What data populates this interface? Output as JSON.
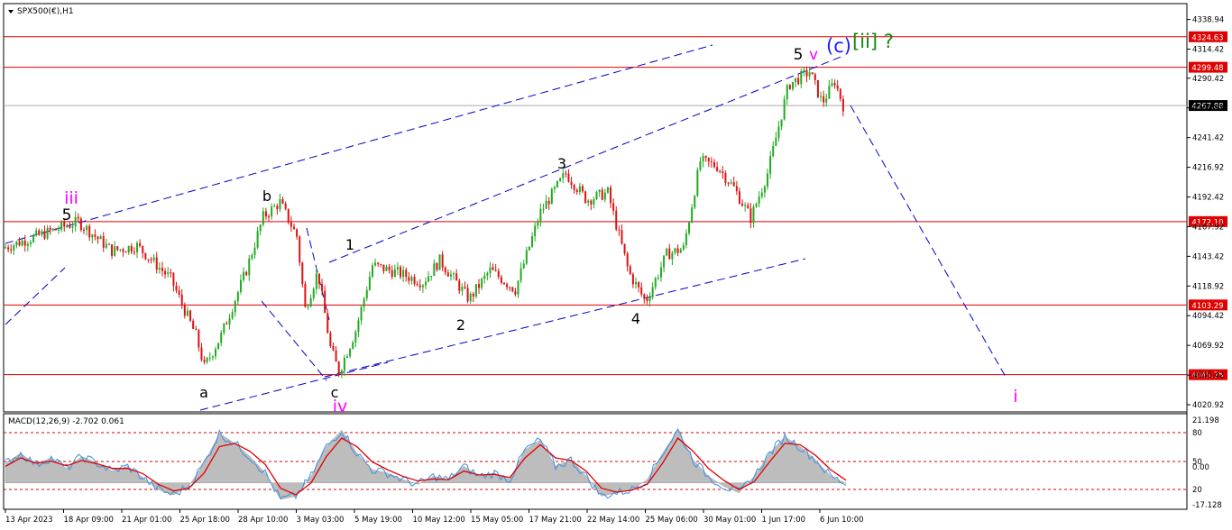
{
  "header": {
    "symbol_label": "SPX500(€),H1",
    "macd_label": "MACD(12,26,9) -2.702 0.061"
  },
  "colors": {
    "background": "#ffffff",
    "bull": "#22aa22",
    "bear": "#dd1111",
    "hline": "#e00000",
    "channel": "#0000cc",
    "wave_black": "#000000",
    "wave_magenta": "#ff00ff",
    "wave_blue": "#1a1aff",
    "wave_green": "#118811",
    "macd_hist": "#bdbdbd",
    "macd_line": "#3a8ee6",
    "macd_signal": "#e00000"
  },
  "chart_data": [
    {
      "type": "candlestick",
      "title": "SPX500(€),H1",
      "ylim": [
        4015,
        4352
      ],
      "y_ticks": [
        "4338.94",
        "4314.42",
        "4290.42",
        "4265.92",
        "4241.42",
        "4216.92",
        "4192.42",
        "4167.92",
        "4143.42",
        "4118.92",
        "4094.42",
        "4069.92",
        "4045.42",
        "4020.92"
      ],
      "x_ticks": [
        "13 Apr 2023",
        "18 Apr 09:00",
        "21 Apr 01:00",
        "25 Apr 18:00",
        "28 Apr 10:00",
        "3 May 03:00",
        "5 May 19:00",
        "10 May 12:00",
        "15 May 05:00",
        "17 May 21:00",
        "22 May 14:00",
        "25 May 06:00",
        "30 May 01:00",
        "1 Jun 17:00",
        "6 Jun 10:00"
      ],
      "price_levels": [
        {
          "value": 4324.63,
          "label": "4324.63"
        },
        {
          "value": 4299.48,
          "label": "4299.48"
        },
        {
          "value": 4172.1,
          "label": "4172.10"
        },
        {
          "value": 4103.29,
          "label": "4103.29"
        },
        {
          "value": 4045.75,
          "label": "4045.75"
        }
      ],
      "current_price": {
        "value": 4267.88,
        "label": "4267.88"
      },
      "swing_points": [
        {
          "t": 0.02,
          "v": 4155
        },
        {
          "t": 0.09,
          "v": 4172
        },
        {
          "t": 0.13,
          "v": 4148
        },
        {
          "t": 0.16,
          "v": 4152
        },
        {
          "t": 0.2,
          "v": 4125
        },
        {
          "t": 0.23,
          "v": 4078
        },
        {
          "t": 0.24,
          "v": 4052
        },
        {
          "t": 0.26,
          "v": 4078
        },
        {
          "t": 0.29,
          "v": 4132
        },
        {
          "t": 0.31,
          "v": 4176
        },
        {
          "t": 0.33,
          "v": 4188
        },
        {
          "t": 0.35,
          "v": 4160
        },
        {
          "t": 0.36,
          "v": 4100
        },
        {
          "t": 0.375,
          "v": 4131
        },
        {
          "t": 0.39,
          "v": 4068
        },
        {
          "t": 0.4,
          "v": 4048
        },
        {
          "t": 0.42,
          "v": 4082
        },
        {
          "t": 0.44,
          "v": 4136
        },
        {
          "t": 0.47,
          "v": 4130
        },
        {
          "t": 0.5,
          "v": 4122
        },
        {
          "t": 0.52,
          "v": 4140
        },
        {
          "t": 0.555,
          "v": 4108
        },
        {
          "t": 0.58,
          "v": 4132
        },
        {
          "t": 0.61,
          "v": 4116
        },
        {
          "t": 0.64,
          "v": 4180
        },
        {
          "t": 0.67,
          "v": 4212
        },
        {
          "t": 0.695,
          "v": 4190
        },
        {
          "t": 0.72,
          "v": 4196
        },
        {
          "t": 0.745,
          "v": 4130
        },
        {
          "t": 0.765,
          "v": 4106
        },
        {
          "t": 0.79,
          "v": 4145
        },
        {
          "t": 0.81,
          "v": 4150
        },
        {
          "t": 0.83,
          "v": 4222
        },
        {
          "t": 0.85,
          "v": 4218
        },
        {
          "t": 0.87,
          "v": 4200
        },
        {
          "t": 0.89,
          "v": 4175
        },
        {
          "t": 0.91,
          "v": 4212
        },
        {
          "t": 0.935,
          "v": 4285
        },
        {
          "t": 0.96,
          "v": 4296
        },
        {
          "t": 0.975,
          "v": 4270
        },
        {
          "t": 0.99,
          "v": 4288
        },
        {
          "t": 1.0,
          "v": 4267.88
        }
      ],
      "wave_labels": [
        {
          "text": "iii",
          "color": "magenta"
        },
        {
          "text": "5",
          "color": "black"
        },
        {
          "text": "a",
          "color": "black"
        },
        {
          "text": "b",
          "color": "black"
        },
        {
          "text": "c",
          "color": "black"
        },
        {
          "text": "iv",
          "color": "magenta"
        },
        {
          "text": "1",
          "color": "black"
        },
        {
          "text": "2",
          "color": "black"
        },
        {
          "text": "3",
          "color": "black"
        },
        {
          "text": "4",
          "color": "black"
        },
        {
          "text": "5",
          "color": "black"
        },
        {
          "text": "v",
          "color": "magenta"
        },
        {
          "text": "(c)",
          "color": "blue"
        },
        {
          "text": "[ii] ?",
          "color": "green"
        },
        {
          "text": "i",
          "color": "magenta"
        }
      ]
    },
    {
      "type": "line",
      "title": "MACD(12,26,9) -2.702 0.061",
      "y_ticks": [
        "21.198",
        "80",
        "50",
        "0.00",
        "20",
        "-17.128"
      ],
      "series": [
        {
          "values": [
            30,
            45,
            28,
            38,
            22,
            40,
            30,
            18,
            25,
            8,
            -10,
            -18,
            -5,
            30,
            75,
            60,
            40,
            15,
            -25,
            -20,
            10,
            55,
            80,
            45,
            20,
            15,
            5,
            -2,
            10,
            5,
            25,
            10,
            15,
            5,
            50,
            65,
            25,
            35,
            10,
            -20,
            -15,
            -10,
            5,
            45,
            80,
            35,
            10,
            -5,
            -15,
            10,
            45,
            70,
            55,
            35,
            10,
            -1
          ]
        },
        {
          "values": [
            25,
            38,
            30,
            33,
            26,
            34,
            29,
            22,
            22,
            14,
            -2,
            -12,
            -8,
            15,
            55,
            60,
            48,
            28,
            -8,
            -18,
            0,
            40,
            68,
            55,
            32,
            20,
            10,
            3,
            6,
            5,
            18,
            12,
            13,
            8,
            38,
            58,
            38,
            34,
            18,
            -8,
            -14,
            -11,
            -2,
            30,
            68,
            48,
            22,
            4,
            -10,
            2,
            32,
            60,
            58,
            42,
            20,
            4
          ]
        }
      ]
    }
  ]
}
